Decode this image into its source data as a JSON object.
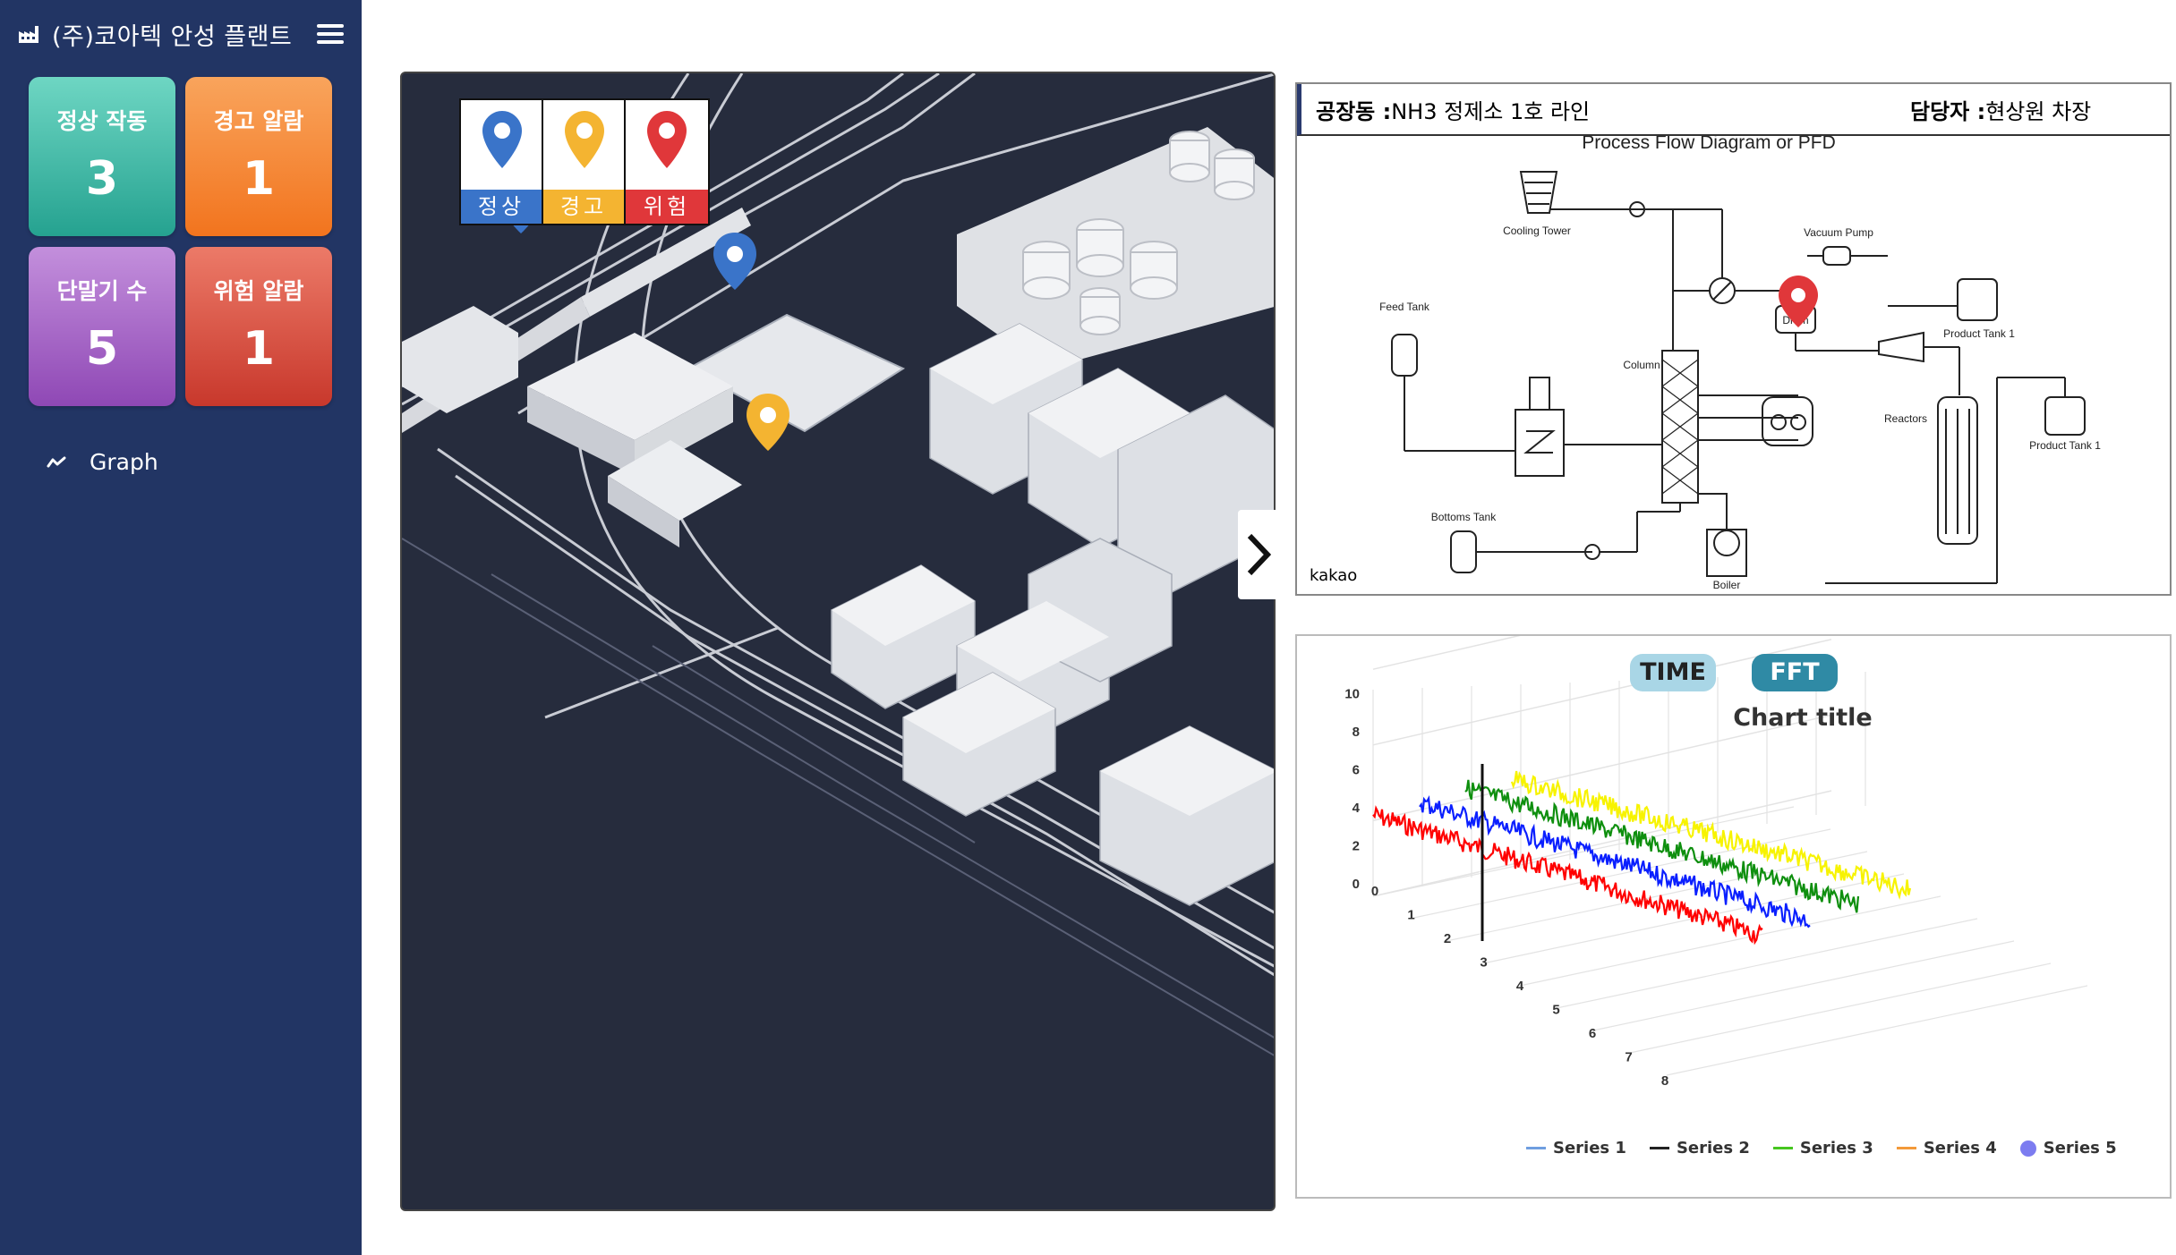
{
  "sidebar": {
    "title": "(주)코아텍 안성 플랜트",
    "cards": [
      {
        "label": "정상 작동",
        "value": "3"
      },
      {
        "label": "경고 알람",
        "value": "1"
      },
      {
        "label": "단말기 수",
        "value": "5"
      },
      {
        "label": "위험 알람",
        "value": "1"
      }
    ],
    "graph_label": "Graph"
  },
  "map": {
    "legend": [
      {
        "label": "정상",
        "color": "#3a74c9"
      },
      {
        "label": "경고",
        "color": "#f4b431"
      },
      {
        "label": "위험",
        "color": "#e0373a"
      }
    ]
  },
  "pfd": {
    "factory_label": "공장동 :",
    "factory_value": "NH3 정제소 1호 라인",
    "manager_label": "담당자 :",
    "manager_value": "현상원 차장",
    "diagram_title": "Process Flow Diagram or PFD",
    "labels": {
      "cooling_tower": "Cooling Tower",
      "vacuum_pump": "Vacuum Pump",
      "feed_tank": "Feed Tank",
      "column": "Column",
      "product_tank_1": "Product Tank 1",
      "product_tank_1b": "Product Tank 1",
      "reactors": "Reactors",
      "bottoms_tank": "Bottoms Tank",
      "boiler": "Boiler",
      "drum": "Drum"
    },
    "watermark": "kakao"
  },
  "chart": {
    "tab_time": "TIME",
    "tab_fft": "FFT"
  },
  "chart_data": {
    "type": "line",
    "title": "Chart title",
    "z_ticks": [
      "0",
      "2",
      "4",
      "6",
      "8",
      "10"
    ],
    "x_ticks": [
      "0",
      "1",
      "2",
      "3",
      "4",
      "5",
      "6",
      "7",
      "8"
    ],
    "ylim": [
      0,
      10
    ],
    "series": [
      {
        "name": "Series 1",
        "color": "#6f9ee0",
        "z": 0,
        "mean": 3.5,
        "noise": 0.5
      },
      {
        "name": "Series 2",
        "color": "#222222",
        "z": 1,
        "mean": 3.6,
        "noise": 0.5
      },
      {
        "name": "Series 3",
        "color": "#46c61f",
        "z": 2,
        "mean": 3.6,
        "noise": 0.5
      },
      {
        "name": "Series 4",
        "color": "#f39a3a",
        "z": 3,
        "mean": 3.7,
        "noise": 0.5
      },
      {
        "name": "Series 5",
        "color": "#7c7cf0",
        "z": 4,
        "mean": 3.7,
        "noise": 0.5
      }
    ]
  }
}
